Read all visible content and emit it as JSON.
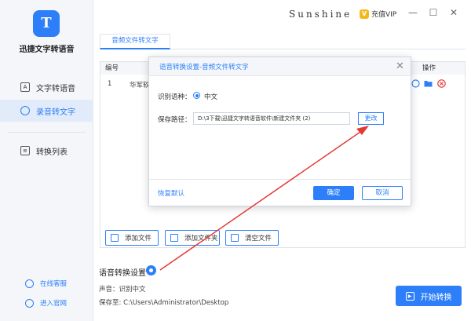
{
  "app": {
    "title": "迅捷文字转语音",
    "logo_letter": "T"
  },
  "sidebar": {
    "items": [
      {
        "label": "文字转语音",
        "icon": "text-a-icon",
        "active": false
      },
      {
        "label": "录音转文字",
        "icon": "microphone-icon",
        "active": true
      },
      {
        "label": "转换列表",
        "icon": "list-icon",
        "active": false
      }
    ],
    "footer": [
      {
        "label": "在线客服",
        "icon": "headset-icon"
      },
      {
        "label": "进入官网",
        "icon": "globe-icon"
      }
    ]
  },
  "titlebar": {
    "brand": "Sunshine",
    "vip_label": "充值VIP",
    "minimize": "—",
    "maximize": "☐",
    "close": "✕"
  },
  "main": {
    "tab": "音频文件转文字",
    "table": {
      "headers": {
        "index": "编号",
        "ops": "操作"
      },
      "rows": [
        {
          "index": "1",
          "name": "华军软"
        }
      ]
    },
    "buttons": {
      "add_file": "添加文件",
      "add_folder": "添加文件夹",
      "clear": "清空文件"
    },
    "settings": {
      "title": "语音转换设置",
      "voice": "声音：识别中文",
      "save_to": "保存至: C:\\Users\\Administrator\\Desktop"
    },
    "start_label": "开始转换"
  },
  "dialog": {
    "title": "语音转换设置-音频文件转文字",
    "lang_label": "识别语种：",
    "lang_value": "中文",
    "path_label": "保存路径：",
    "path_value": "D:\\3下载\\迅捷文字转语音软件\\新建文件夹 (2)",
    "change": "更改",
    "reset": "恢复默认",
    "ok": "确定",
    "cancel": "取消"
  },
  "colors": {
    "accent": "#2d7ff9",
    "delete": "#e53935",
    "annotation": "#e53935"
  }
}
